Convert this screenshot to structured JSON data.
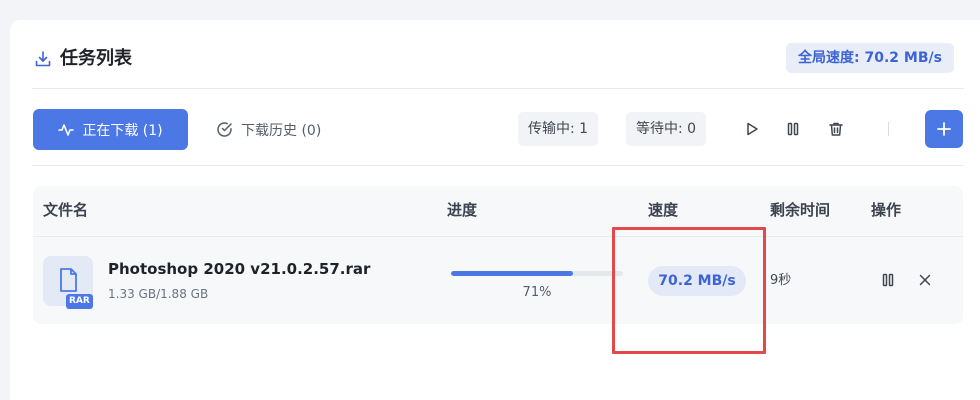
{
  "header": {
    "title": "任务列表",
    "icon": "download-icon",
    "global_speed": "全局速度: 70.2 MB/s"
  },
  "toolbar": {
    "downloading_label": "正在下载 (1)",
    "history_label": "下载历史 (0)",
    "transferring": "传输中: 1",
    "waiting": "等待中: 0",
    "icons": [
      "play-icon",
      "pause-icon",
      "trash-icon",
      "plus-icon"
    ]
  },
  "table": {
    "columns": {
      "filename": "文件名",
      "progress": "进度",
      "speed": "速度",
      "remaining": "剩余时间",
      "actions": "操作"
    },
    "rows": [
      {
        "file_type": "RAR",
        "name": "Photoshop 2020 v21.0.2.57.rar",
        "size": "1.33 GB/1.88 GB",
        "progress_percent": 71,
        "progress_text": "71%",
        "speed": "70.2 MB/s",
        "remaining": "9秒"
      }
    ]
  },
  "colors": {
    "accent": "#4c78e6",
    "highlight": "#e54848"
  }
}
